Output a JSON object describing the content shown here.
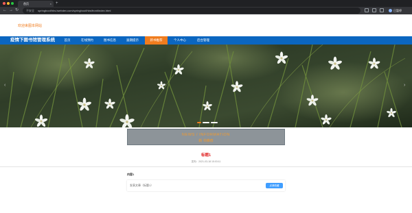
{
  "browser": {
    "tab_title": "首页",
    "tab_close": "×",
    "new_tab": "+",
    "back": "←",
    "forward": "→",
    "reload": "↻",
    "security_label": "不安全",
    "url": "springboot/hbs.iwebdev.com/springboot/hbs/front/index.html",
    "profile_label": "已暂停"
  },
  "site": {
    "welcome": "欢迎来图本网站",
    "title": "疫情下图书馆管理系统"
  },
  "nav": {
    "items": [
      {
        "label": "首页"
      },
      {
        "label": "在线预约"
      },
      {
        "label": "图书信息"
      },
      {
        "label": "逾期提示"
      },
      {
        "label": "新书推荐"
      },
      {
        "label": "个人中心"
      },
      {
        "label": "后台管理"
      }
    ],
    "active_index": 4
  },
  "banner": {
    "prev": "‹",
    "next": "›",
    "indicator_count": 3,
    "active_indicator": 1
  },
  "news_header": {
    "en": "NEWS / INFORMATION",
    "cn": "新 书推荐"
  },
  "detail": {
    "title": "标题1",
    "time": "发布：2021-03-18 15:03:11",
    "content_label": "内容1",
    "content_text": "发表文章（标题1）",
    "collect_button": "点我收藏"
  },
  "colors": {
    "nav_bg": "#0b66c0",
    "accent": "#f07c1e",
    "title_red": "#e02424",
    "button_blue": "#409eff"
  }
}
